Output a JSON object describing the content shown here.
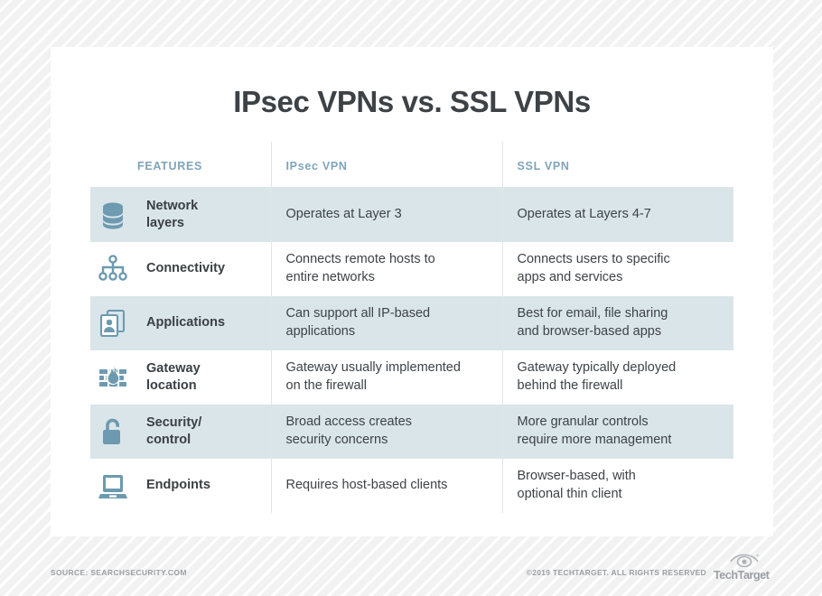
{
  "page": {
    "title": "IPsec VPNs vs. SSL VPNs",
    "colors": {
      "accent_blue": "#7ea5bb",
      "icon_blue": "#6d9ab0",
      "row_shade": "#dae5ea",
      "body_text": "#3d4347",
      "footer_text": "#9b9ea2",
      "background": "#f3f3f4",
      "card": "#ffffff"
    }
  },
  "table": {
    "headers": {
      "features": "FEATURES",
      "ipsec": "IPsec VPN",
      "ssl": "SSL VPN"
    },
    "rows": [
      {
        "icon": "database-stack-icon",
        "feature": "Network layers",
        "feature_line1": "Network",
        "feature_line2": "layers",
        "ipsec": "Operates at Layer 3",
        "ssl": "Operates at Layers 4-7",
        "shaded": true
      },
      {
        "icon": "network-tree-icon",
        "feature": "Connectivity",
        "feature_line1": "Connectivity",
        "feature_line2": "",
        "ipsec": "Connects remote hosts to entire networks",
        "ipsec_line1": "Connects remote hosts to",
        "ipsec_line2": "entire networks",
        "ssl": "Connects users to specific apps and services",
        "ssl_line1": "Connects users to specific",
        "ssl_line2": "apps and services",
        "shaded": false
      },
      {
        "icon": "documents-person-icon",
        "feature": "Applications",
        "feature_line1": "Applications",
        "feature_line2": "",
        "ipsec": "Can support all IP-based applications",
        "ipsec_line1": "Can support all IP-based",
        "ipsec_line2": "applications",
        "ssl": "Best for email, file sharing and browser-based apps",
        "ssl_line1": "Best for email, file sharing",
        "ssl_line2": "and browser-based apps",
        "shaded": true
      },
      {
        "icon": "firewall-flame-icon",
        "feature": "Gateway location",
        "feature_line1": "Gateway",
        "feature_line2": "location",
        "ipsec": "Gateway usually implemented on the firewall",
        "ipsec_line1": "Gateway usually implemented",
        "ipsec_line2": "on the firewall",
        "ssl": "Gateway typically deployed behind the firewall",
        "ssl_line1": "Gateway typically deployed",
        "ssl_line2": "behind the firewall",
        "shaded": false
      },
      {
        "icon": "open-padlock-icon",
        "feature": "Security/control",
        "feature_line1": "Security/",
        "feature_line2": "control",
        "ipsec": "Broad access creates security concerns",
        "ipsec_line1": "Broad access creates",
        "ipsec_line2": "security concerns",
        "ssl": "More granular controls require more management",
        "ssl_line1": "More granular controls",
        "ssl_line2": "require more management",
        "shaded": true
      },
      {
        "icon": "laptop-icon",
        "feature": "Endpoints",
        "feature_line1": "Endpoints",
        "feature_line2": "",
        "ipsec": "Requires host-based clients",
        "ipsec_line1": "Requires host-based clients",
        "ipsec_line2": "",
        "ssl": "Browser-based, with optional thin client",
        "ssl_line1": "Browser-based, with",
        "ssl_line2": "optional thin client",
        "shaded": false
      }
    ]
  },
  "footer": {
    "source": "SOURCE: SEARCHSECURITY.COM",
    "copyright": "©2019 TECHTARGET. ALL RIGHTS RESERVED",
    "brand": "TechTarget"
  }
}
